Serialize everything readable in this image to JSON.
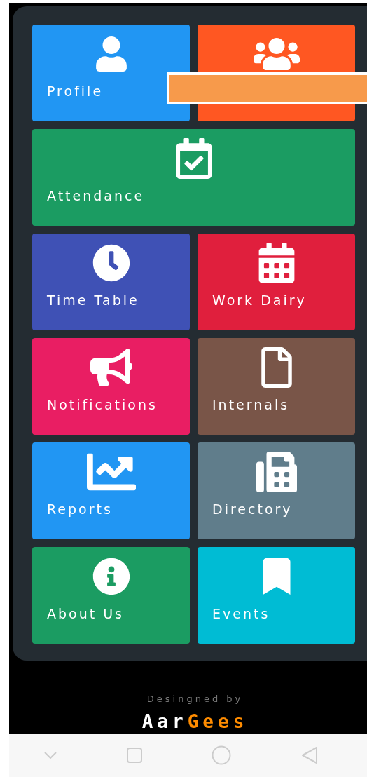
{
  "tiles": [
    {
      "label": "Profile",
      "color": "#2196f3",
      "wide": false
    },
    {
      "color": "#ff5722",
      "wide": false
    },
    {
      "label": "Attendance",
      "color": "#1b9c62",
      "wide": true
    },
    {
      "label": "Time Table",
      "color": "#3f51b5",
      "wide": false
    },
    {
      "label": "Work Dairy",
      "color": "#e01f3d",
      "wide": false
    },
    {
      "label": "Notifications",
      "color": "#e91e63",
      "wide": false
    },
    {
      "label": "Internals",
      "color": "#795548",
      "wide": false
    },
    {
      "label": "Reports",
      "color": "#2196f3",
      "wide": false
    },
    {
      "label": "Directory",
      "color": "#607d8b",
      "wide": false
    },
    {
      "label": "About Us",
      "color": "#1b9c62",
      "wide": false
    },
    {
      "label": "Events",
      "color": "#00bcd4",
      "wide": false
    }
  ],
  "footer": {
    "credit": "Desingned by",
    "logo": [
      {
        "text": "Aar",
        "color": "#ffffff"
      },
      {
        "text": "Gees",
        "color": "#ff8c00"
      }
    ]
  }
}
